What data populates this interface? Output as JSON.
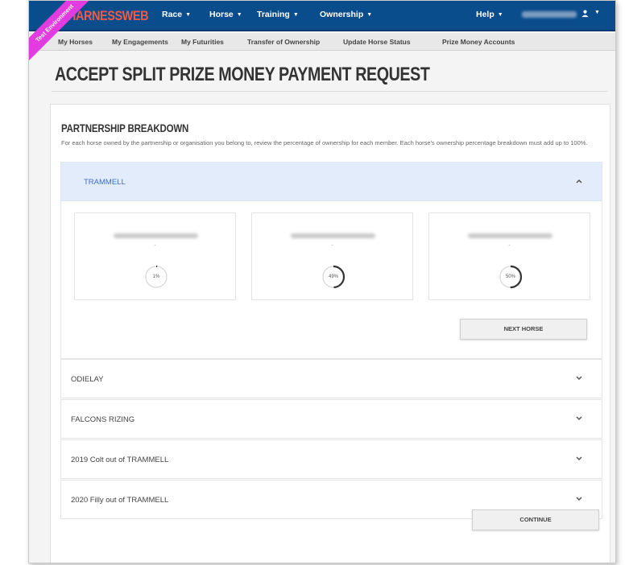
{
  "brand": {
    "name": "HARNESSWEB",
    "badge": "Test Environment"
  },
  "nav": {
    "items": [
      "Race",
      "Horse",
      "Training",
      "Ownership"
    ],
    "help": "Help",
    "user_icon": "user-circle-icon",
    "caret_icon": "caret-down-icon"
  },
  "subnav": [
    "My Horses",
    "My Engagements",
    "My Futurities",
    "Transfer of Ownership",
    "Update Horse Status",
    "Prize Money Accounts"
  ],
  "page": {
    "title": "ACCEPT SPLIT PRIZE MONEY PAYMENT REQUEST"
  },
  "section": {
    "title": "PARTNERSHIP BREAKDOWN",
    "description": "For each horse owned by the partnership or organisation you belong to, review the percentage of ownership for each member. Each horse's ownership percentage breakdown must add up to 100%."
  },
  "accordion": {
    "open": {
      "label": "TRAMMELL",
      "chevron_icon": "chevron-up-icon",
      "members": [
        {
          "dash": "-",
          "percent_label": "1%",
          "percent": 1
        },
        {
          "dash": "-",
          "percent_label": "49%",
          "percent": 49
        },
        {
          "dash": "-",
          "percent_label": "50%",
          "percent": 50
        }
      ],
      "next_label": "NEXT HORSE"
    },
    "collapsed": [
      {
        "label": "ODIELAY"
      },
      {
        "label": "FALCONS RIZING"
      },
      {
        "label": "2019 Colt out of TRAMMELL"
      },
      {
        "label": "2020 Filly out of TRAMMELL"
      }
    ],
    "chevron_down_icon": "chevron-down-icon"
  },
  "actions": {
    "continue_label": "CONTINUE"
  },
  "colors": {
    "navbar": "#0a4d8c",
    "brand": "#f15a4a",
    "accent": "#3d6fc4",
    "ribbon": "#e23be0",
    "open_header": "#e3ecfb"
  }
}
